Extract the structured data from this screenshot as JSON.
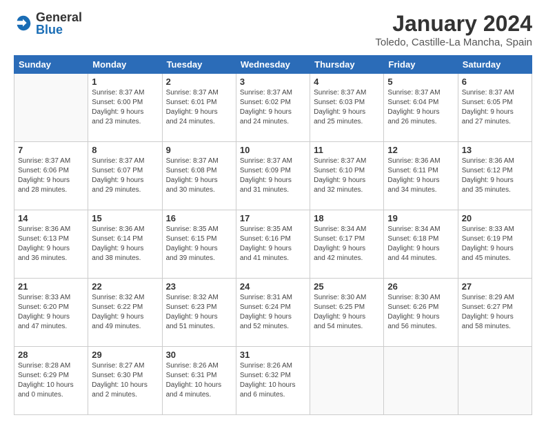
{
  "logo": {
    "general": "General",
    "blue": "Blue"
  },
  "title": "January 2024",
  "location": "Toledo, Castille-La Mancha, Spain",
  "headers": [
    "Sunday",
    "Monday",
    "Tuesday",
    "Wednesday",
    "Thursday",
    "Friday",
    "Saturday"
  ],
  "weeks": [
    [
      {
        "day": "",
        "info": ""
      },
      {
        "day": "1",
        "info": "Sunrise: 8:37 AM\nSunset: 6:00 PM\nDaylight: 9 hours\nand 23 minutes."
      },
      {
        "day": "2",
        "info": "Sunrise: 8:37 AM\nSunset: 6:01 PM\nDaylight: 9 hours\nand 24 minutes."
      },
      {
        "day": "3",
        "info": "Sunrise: 8:37 AM\nSunset: 6:02 PM\nDaylight: 9 hours\nand 24 minutes."
      },
      {
        "day": "4",
        "info": "Sunrise: 8:37 AM\nSunset: 6:03 PM\nDaylight: 9 hours\nand 25 minutes."
      },
      {
        "day": "5",
        "info": "Sunrise: 8:37 AM\nSunset: 6:04 PM\nDaylight: 9 hours\nand 26 minutes."
      },
      {
        "day": "6",
        "info": "Sunrise: 8:37 AM\nSunset: 6:05 PM\nDaylight: 9 hours\nand 27 minutes."
      }
    ],
    [
      {
        "day": "7",
        "info": "Sunrise: 8:37 AM\nSunset: 6:06 PM\nDaylight: 9 hours\nand 28 minutes."
      },
      {
        "day": "8",
        "info": "Sunrise: 8:37 AM\nSunset: 6:07 PM\nDaylight: 9 hours\nand 29 minutes."
      },
      {
        "day": "9",
        "info": "Sunrise: 8:37 AM\nSunset: 6:08 PM\nDaylight: 9 hours\nand 30 minutes."
      },
      {
        "day": "10",
        "info": "Sunrise: 8:37 AM\nSunset: 6:09 PM\nDaylight: 9 hours\nand 31 minutes."
      },
      {
        "day": "11",
        "info": "Sunrise: 8:37 AM\nSunset: 6:10 PM\nDaylight: 9 hours\nand 32 minutes."
      },
      {
        "day": "12",
        "info": "Sunrise: 8:36 AM\nSunset: 6:11 PM\nDaylight: 9 hours\nand 34 minutes."
      },
      {
        "day": "13",
        "info": "Sunrise: 8:36 AM\nSunset: 6:12 PM\nDaylight: 9 hours\nand 35 minutes."
      }
    ],
    [
      {
        "day": "14",
        "info": "Sunrise: 8:36 AM\nSunset: 6:13 PM\nDaylight: 9 hours\nand 36 minutes."
      },
      {
        "day": "15",
        "info": "Sunrise: 8:36 AM\nSunset: 6:14 PM\nDaylight: 9 hours\nand 38 minutes."
      },
      {
        "day": "16",
        "info": "Sunrise: 8:35 AM\nSunset: 6:15 PM\nDaylight: 9 hours\nand 39 minutes."
      },
      {
        "day": "17",
        "info": "Sunrise: 8:35 AM\nSunset: 6:16 PM\nDaylight: 9 hours\nand 41 minutes."
      },
      {
        "day": "18",
        "info": "Sunrise: 8:34 AM\nSunset: 6:17 PM\nDaylight: 9 hours\nand 42 minutes."
      },
      {
        "day": "19",
        "info": "Sunrise: 8:34 AM\nSunset: 6:18 PM\nDaylight: 9 hours\nand 44 minutes."
      },
      {
        "day": "20",
        "info": "Sunrise: 8:33 AM\nSunset: 6:19 PM\nDaylight: 9 hours\nand 45 minutes."
      }
    ],
    [
      {
        "day": "21",
        "info": "Sunrise: 8:33 AM\nSunset: 6:20 PM\nDaylight: 9 hours\nand 47 minutes."
      },
      {
        "day": "22",
        "info": "Sunrise: 8:32 AM\nSunset: 6:22 PM\nDaylight: 9 hours\nand 49 minutes."
      },
      {
        "day": "23",
        "info": "Sunrise: 8:32 AM\nSunset: 6:23 PM\nDaylight: 9 hours\nand 51 minutes."
      },
      {
        "day": "24",
        "info": "Sunrise: 8:31 AM\nSunset: 6:24 PM\nDaylight: 9 hours\nand 52 minutes."
      },
      {
        "day": "25",
        "info": "Sunrise: 8:30 AM\nSunset: 6:25 PM\nDaylight: 9 hours\nand 54 minutes."
      },
      {
        "day": "26",
        "info": "Sunrise: 8:30 AM\nSunset: 6:26 PM\nDaylight: 9 hours\nand 56 minutes."
      },
      {
        "day": "27",
        "info": "Sunrise: 8:29 AM\nSunset: 6:27 PM\nDaylight: 9 hours\nand 58 minutes."
      }
    ],
    [
      {
        "day": "28",
        "info": "Sunrise: 8:28 AM\nSunset: 6:29 PM\nDaylight: 10 hours\nand 0 minutes."
      },
      {
        "day": "29",
        "info": "Sunrise: 8:27 AM\nSunset: 6:30 PM\nDaylight: 10 hours\nand 2 minutes."
      },
      {
        "day": "30",
        "info": "Sunrise: 8:26 AM\nSunset: 6:31 PM\nDaylight: 10 hours\nand 4 minutes."
      },
      {
        "day": "31",
        "info": "Sunrise: 8:26 AM\nSunset: 6:32 PM\nDaylight: 10 hours\nand 6 minutes."
      },
      {
        "day": "",
        "info": ""
      },
      {
        "day": "",
        "info": ""
      },
      {
        "day": "",
        "info": ""
      }
    ]
  ]
}
